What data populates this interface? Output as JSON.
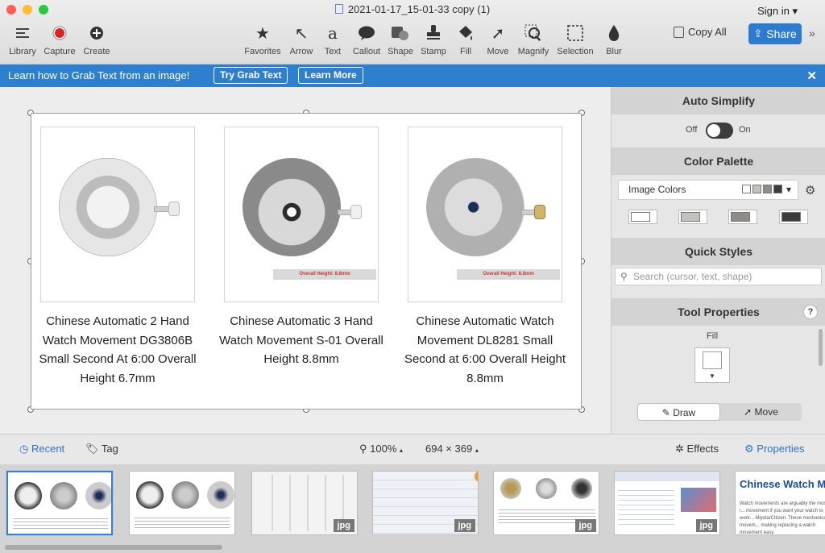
{
  "window": {
    "title": "2021-01-17_15-01-33 copy (1)",
    "signin": "Sign in"
  },
  "toolbar": {
    "left": [
      {
        "label": "Library",
        "icon": "library-icon"
      },
      {
        "label": "Capture",
        "icon": "capture-icon"
      },
      {
        "label": "Create",
        "icon": "create-icon"
      }
    ],
    "tools": [
      {
        "label": "Favorites",
        "icon": "star-icon"
      },
      {
        "label": "Arrow",
        "icon": "arrow-icon"
      },
      {
        "label": "Text",
        "icon": "text-icon"
      },
      {
        "label": "Callout",
        "icon": "callout-icon"
      },
      {
        "label": "Shape",
        "icon": "shape-icon"
      },
      {
        "label": "Stamp",
        "icon": "stamp-icon"
      },
      {
        "label": "Fill",
        "icon": "fill-icon"
      },
      {
        "label": "Move",
        "icon": "move-icon"
      },
      {
        "label": "Magnify",
        "icon": "magnify-icon"
      },
      {
        "label": "Selection",
        "icon": "selection-icon"
      },
      {
        "label": "Blur",
        "icon": "blur-icon"
      }
    ],
    "copy_all": "Copy All",
    "share": "Share"
  },
  "banner": {
    "text": "Learn how to Grab Text from an image!",
    "try_button": "Try Grab Text",
    "learn_button": "Learn More"
  },
  "products": [
    {
      "caption": "Chinese Automatic 2 Hand Watch Movement DG3806B Small Second At 6:00 Overall Height 6.7mm",
      "measure": ""
    },
    {
      "caption": "Chinese Automatic 3 Hand Watch Movement S-01 Overall Height 8.8mm",
      "measure": "Overall Height: 8.8mm"
    },
    {
      "caption": "Chinese Automatic Watch Movement DL8281 Small Second at 6:00 Overall Height 8.8mm",
      "measure": "Overall Height: 8.8mm"
    }
  ],
  "panel": {
    "auto_simplify": {
      "title": "Auto Simplify",
      "off": "Off",
      "on": "On"
    },
    "color_palette": {
      "title": "Color Palette",
      "dropdown": "Image Colors",
      "colors": [
        "#ffffff",
        "#c4c0bc",
        "#918b86",
        "#3d3b39"
      ]
    },
    "quick_styles": {
      "title": "Quick Styles",
      "placeholder": "Search (cursor, text, shape)"
    },
    "tool_properties": {
      "title": "Tool Properties",
      "fill_label": "Fill",
      "draw": "Draw",
      "move": "Move"
    }
  },
  "bottom": {
    "recent": "Recent",
    "tag": "Tag",
    "zoom": "100%",
    "size": "694 × 369",
    "effects": "Effects",
    "properties": "Properties"
  },
  "thumbnails": [
    {
      "tag": ""
    },
    {
      "tag": ""
    },
    {
      "tag": "jpg"
    },
    {
      "tag": "jpg"
    },
    {
      "tag": "jpg"
    },
    {
      "tag": "jpg"
    },
    {
      "tag": "",
      "heading": "Chinese Watch M",
      "text": "Watch movements are arguably the most i... movement if you want your watch to work... Miyota/Citizen. These mechanical movem... making replacing a watch movement easy"
    }
  ]
}
